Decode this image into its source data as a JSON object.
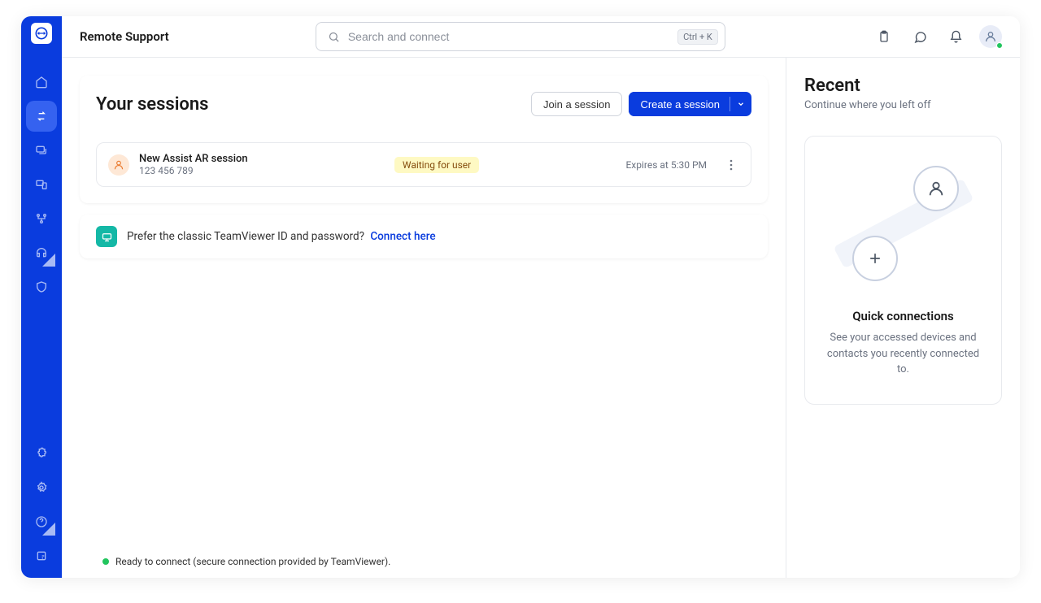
{
  "header": {
    "title": "Remote Support",
    "search_placeholder": "Search and connect",
    "shortcut": "Ctrl + K"
  },
  "sessions": {
    "title": "Your sessions",
    "join_label": "Join a session",
    "create_label": "Create a session",
    "items": [
      {
        "name": "New Assist AR session",
        "id": "123 456 789",
        "status": "Waiting for user",
        "expires": "Expires at 5:30 PM"
      }
    ]
  },
  "classic": {
    "text": "Prefer the classic TeamViewer ID and password?",
    "link": "Connect here"
  },
  "recent": {
    "title": "Recent",
    "subtitle": "Continue where you left off",
    "quick_title": "Quick connections",
    "quick_desc": "See your accessed devices and contacts you recently connected to."
  },
  "status": {
    "text": "Ready to connect (secure connection provided by TeamViewer)."
  },
  "colors": {
    "primary": "#0a3cde",
    "accent": "#14b8a6"
  }
}
